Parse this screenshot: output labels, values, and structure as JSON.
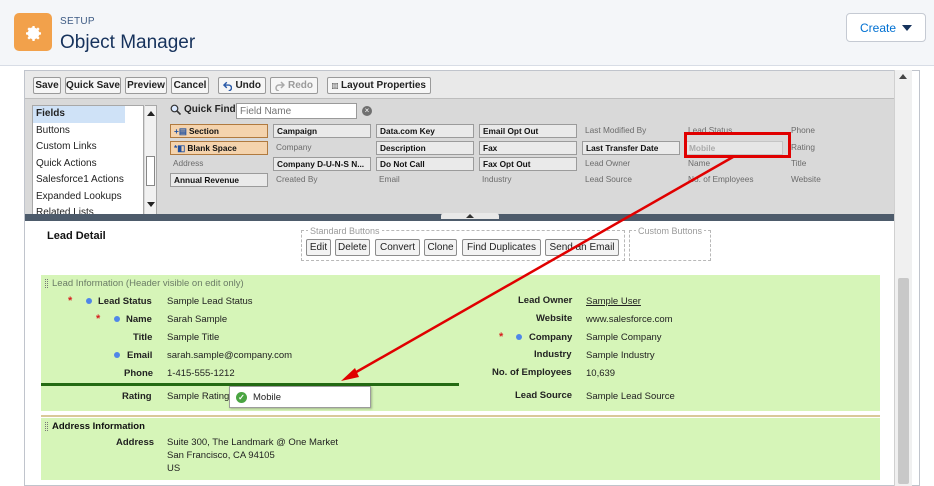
{
  "header": {
    "setup_label": "SETUP",
    "title": "Object Manager",
    "create_label": "Create",
    "app_icon": "gear-icon",
    "accent": "#f2a14b"
  },
  "toolbar": {
    "save": "Save",
    "quick_save": "Quick Save",
    "preview": "Preview",
    "cancel": "Cancel",
    "undo": "Undo",
    "redo": "Redo",
    "layout_properties": "Layout Properties"
  },
  "categories": [
    "Fields",
    "Buttons",
    "Custom Links",
    "Quick Actions",
    "Salesforce1 Actions",
    "Expanded Lookups",
    "Related Lists"
  ],
  "quick_find": {
    "label": "Quick Find",
    "placeholder": "Field Name"
  },
  "palette_fields": [
    [
      "Section",
      "Campaign",
      "Data.com Key",
      "Email Opt Out",
      "Last Modified By",
      "Lead Status",
      "Phone"
    ],
    [
      "Blank Space",
      "Company",
      "Description",
      "Fax",
      "Last Transfer Date",
      "Mobile",
      "Rating"
    ],
    [
      "Address",
      "Company D-U-N-S N...",
      "Do Not Call",
      "Fax Opt Out",
      "Lead Owner",
      "Name",
      "Title"
    ],
    [
      "Annual Revenue",
      "Created By",
      "Email",
      "Industry",
      "Lead Source",
      "No. of Employees",
      "Website"
    ]
  ],
  "layout": {
    "title": "Lead Detail",
    "standard_buttons_label": "Standard Buttons",
    "custom_buttons_label": "Custom Buttons",
    "buttons": [
      "Edit",
      "Delete",
      "Convert",
      "Clone",
      "Find Duplicates",
      "Send an Email"
    ],
    "section1_header": "Lead Information (Header visible on edit only)",
    "left_fields": [
      {
        "label": "Lead Status",
        "value": "Sample Lead Status"
      },
      {
        "label": "Name",
        "value": "Sarah Sample"
      },
      {
        "label": "Title",
        "value": "Sample Title"
      },
      {
        "label": "Email",
        "value": "sarah.sample@company.com"
      },
      {
        "label": "Phone",
        "value": "1-415-555-1212"
      },
      {
        "label": "Rating",
        "value": "Sample Rating"
      }
    ],
    "right_fields": [
      {
        "label": "Lead Owner",
        "value": "Sample User"
      },
      {
        "label": "Website",
        "value": "www.salesforce.com"
      },
      {
        "label": "Company",
        "value": "Sample Company"
      },
      {
        "label": "Industry",
        "value": "Sample Industry"
      },
      {
        "label": "No. of Employees",
        "value": "10,639"
      },
      {
        "label": "Lead Source",
        "value": "Sample Lead Source"
      }
    ],
    "drag_chip": "Mobile",
    "section2_header": "Address Information",
    "address_label": "Address",
    "address_lines": [
      "Suite 300, The Landmark @ One Market",
      "San Francisco, CA 94105",
      "US"
    ]
  },
  "colors": {
    "section_bg": "#d6f5b8",
    "drop_line": "#236a12",
    "highlight": "#e00000",
    "required": "#d71f1f",
    "info_dot": "#4f86e8"
  }
}
